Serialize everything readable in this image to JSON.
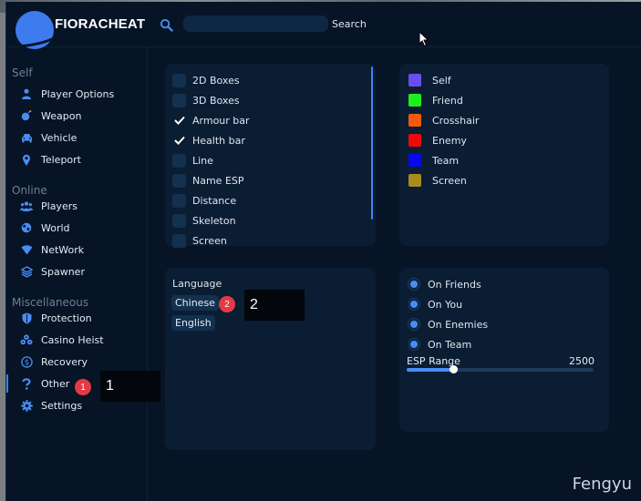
{
  "app": {
    "name": "FIORACHEAT"
  },
  "search": {
    "placeholder": "",
    "button_label": "Search"
  },
  "sidebar": {
    "sections": [
      {
        "title": "Self",
        "items": [
          {
            "label": "Player Options",
            "icon": "user-icon"
          },
          {
            "label": "Weapon",
            "icon": "bomb-icon"
          },
          {
            "label": "Vehicle",
            "icon": "car-icon"
          },
          {
            "label": "Teleport",
            "icon": "location-pin-icon"
          }
        ]
      },
      {
        "title": "Online",
        "items": [
          {
            "label": "Players",
            "icon": "users-icon"
          },
          {
            "label": "World",
            "icon": "globe-icon"
          },
          {
            "label": "NetWork",
            "icon": "wifi-icon"
          },
          {
            "label": "Spawner",
            "icon": "layers-icon"
          }
        ]
      },
      {
        "title": "Miscellaneous",
        "items": [
          {
            "label": "Protection",
            "icon": "shield-icon"
          },
          {
            "label": "Casino Heist",
            "icon": "dice-icon"
          },
          {
            "label": "Recovery",
            "icon": "dollar-icon"
          },
          {
            "label": "Other",
            "icon": "question-icon",
            "active": true
          },
          {
            "label": "Settings",
            "icon": "gear-icon"
          }
        ]
      }
    ]
  },
  "annotations": {
    "badge_1": "1",
    "box_1": "1",
    "badge_2": "2",
    "box_2": "2"
  },
  "esp_options": [
    {
      "label": "2D Boxes",
      "checked": false
    },
    {
      "label": "3D Boxes",
      "checked": false
    },
    {
      "label": "Armour bar",
      "checked": true
    },
    {
      "label": "Health bar",
      "checked": true
    },
    {
      "label": "Line",
      "checked": false
    },
    {
      "label": "Name ESP",
      "checked": false
    },
    {
      "label": "Distance",
      "checked": false
    },
    {
      "label": "Skeleton",
      "checked": false
    },
    {
      "label": "Screen",
      "checked": false
    }
  ],
  "colors": [
    {
      "label": "Self",
      "color": "#6a4ff0"
    },
    {
      "label": "Friend",
      "color": "#1ef01e"
    },
    {
      "label": "Crosshair",
      "color": "#f05a0a"
    },
    {
      "label": "Enemy",
      "color": "#f00808"
    },
    {
      "label": "Team",
      "color": "#0808f0"
    },
    {
      "label": "Screen",
      "color": "#a88a1e"
    }
  ],
  "language": {
    "title": "Language",
    "options": [
      "Chinese",
      "English"
    ]
  },
  "targets": [
    {
      "label": "On Friends"
    },
    {
      "label": "On You"
    },
    {
      "label": "On Enemies"
    },
    {
      "label": "On Team"
    }
  ],
  "esp_range": {
    "label": "ESP Range",
    "value": "2500",
    "fraction": 0.25
  },
  "watermark": "Fengyu",
  "theme": {
    "accent": "#3d7bef",
    "background": "#061426",
    "panel": "#0a1d33"
  }
}
